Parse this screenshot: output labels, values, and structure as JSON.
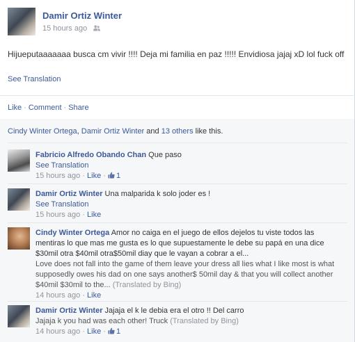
{
  "post": {
    "author": "Damir Ortiz Winter",
    "timestamp": "15 hours ago",
    "audience_icon": "friends-icon",
    "text": "Hijueputaaaaaaa busca cm vivir !!!! Deja mi familia en paz !!!!! Envidiosa jajaj xD lol fuck off",
    "see_translation": "See Translation"
  },
  "actions": {
    "like": "Like",
    "comment": "Comment",
    "share": "Share",
    "separator": "·"
  },
  "likes_summary": {
    "name1": "Cindy Winter Ortega",
    "sep": ",",
    "name2": "Damir Ortiz Winter",
    "and": "and",
    "others": "13 others",
    "suffix": "like this."
  },
  "comments": [
    {
      "author": "Fabricio Alfredo Obando Chan",
      "text": "Que paso",
      "see_translation": "See Translation",
      "timestamp": "15 hours ago",
      "like": "Like",
      "like_count": "1"
    },
    {
      "author": "Damir Ortiz Winter",
      "text": "Una malparida k solo joder es !",
      "see_translation": "See Translation",
      "timestamp": "15 hours ago",
      "like": "Like"
    },
    {
      "author": "Cindy Winter Ortega",
      "text": "Amor no caiga en el juego de ellos dejelos tu viste todos las mentiras lo que mas me gusta es lo que supuestamente le debe su papá en una dice $30mil otra $40mil otra$50mil diay que le vayan a cobrar a el...",
      "translation": "Love does not fall into the game of them leave your dress all lies what I like most is what supposedly owes his dad on one says another$ 50mil day & that you will collect another $40mil $30mil to the...",
      "translated_by": "(Translated by Bing)",
      "timestamp": "14 hours ago",
      "like": "Like"
    },
    {
      "author": "Damir Ortiz Winter",
      "text": "Jajaja el k le debia era el otro !! Del carro",
      "translation": "Jajaja k you had was each other! Truck",
      "translated_by": "(Translated by Bing)",
      "timestamp": "14 hours ago",
      "like": "Like",
      "like_count": "1"
    }
  ]
}
